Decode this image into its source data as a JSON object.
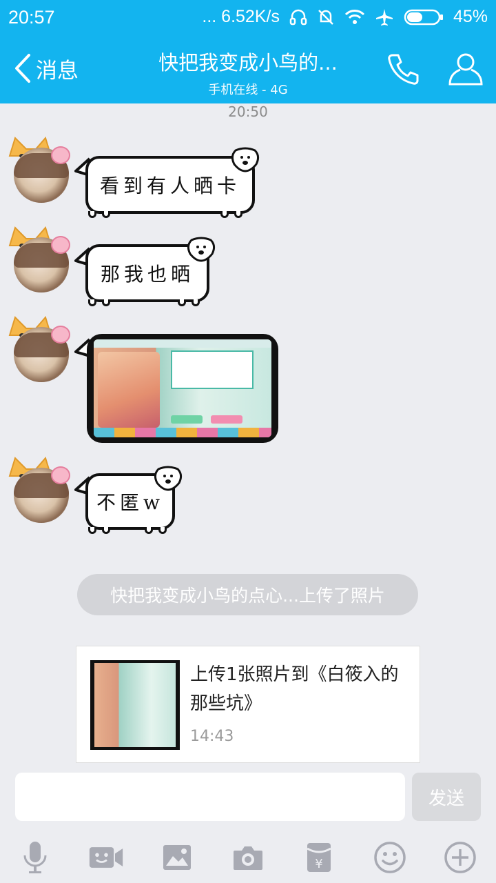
{
  "status_bar": {
    "time": "20:57",
    "network_speed": "... 6.52K/s",
    "battery": "45%"
  },
  "header": {
    "back_label": "消息",
    "title": "快把我变成小鸟的...",
    "subtitle": "手机在线 - 4G"
  },
  "chat": {
    "timestamp": "20:50",
    "messages": [
      {
        "type": "sticker-text",
        "text": "看到有人晒卡"
      },
      {
        "type": "sticker-text",
        "text": "那我也晒"
      },
      {
        "type": "image"
      },
      {
        "type": "sticker-text",
        "text": "不匿w"
      }
    ],
    "system_notice": "快把我变成小鸟的点心...上传了照片",
    "upload_card": {
      "title": "上传1张照片到《白筱入的那些坑》",
      "time": "14:43"
    }
  },
  "composer": {
    "input_value": "",
    "send_label": "发送"
  },
  "toolbar": {
    "icons": [
      "microphone-icon",
      "video-call-icon",
      "image-icon",
      "camera-icon",
      "red-packet-icon",
      "emoji-icon",
      "plus-icon"
    ]
  },
  "colors": {
    "header_bg": "#13b4ef",
    "chat_bg": "#ecedf1"
  }
}
